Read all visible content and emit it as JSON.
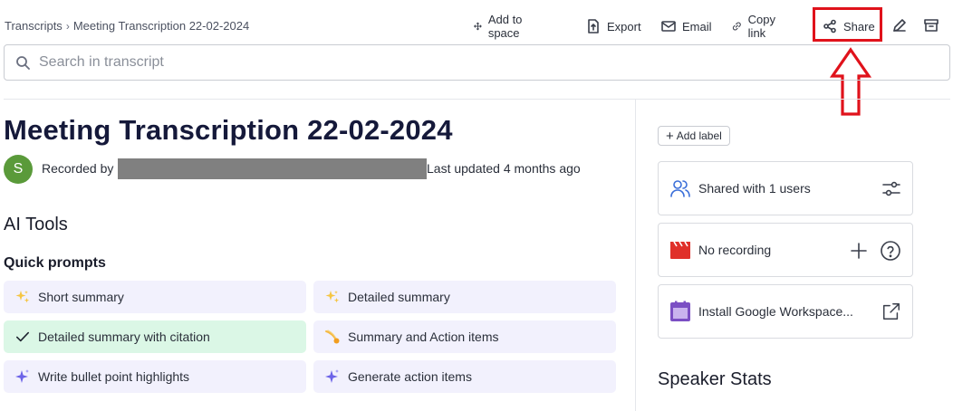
{
  "breadcrumb": {
    "root": "Transcripts",
    "current": "Meeting Transcription 22-02-2024"
  },
  "toolbar": {
    "add_to_space": "Add to space",
    "export": "Export",
    "email": "Email",
    "copy_link": "Copy link",
    "share": "Share"
  },
  "search": {
    "placeholder": "Search in transcript"
  },
  "meeting": {
    "title": "Meeting Transcription 22-02-2024",
    "avatar_initial": "S",
    "recorded_by": "Recorded by",
    "last_updated": "Last updated 4 months ago"
  },
  "ai_tools": {
    "heading": "AI Tools",
    "quick_prompts_heading": "Quick prompts",
    "prompts": [
      {
        "label": "Short summary",
        "icon": "sparkles-icon"
      },
      {
        "label": "Detailed summary",
        "icon": "sparkles-icon"
      },
      {
        "label": "Detailed summary with citation",
        "icon": "check-icon",
        "active": true
      },
      {
        "label": "Summary and Action items",
        "icon": "comet-icon"
      },
      {
        "label": "Write bullet point highlights",
        "icon": "sparkle-purple-icon"
      },
      {
        "label": "Generate action items",
        "icon": "sparkle-purple-icon"
      }
    ]
  },
  "sidebar": {
    "add_label": "Add label",
    "shared": "Shared with 1 users",
    "no_recording": "No recording",
    "install": "Install Google Workspace...",
    "speaker_stats": "Speaker Stats"
  },
  "colors": {
    "accent_highlight": "#e0121b",
    "prompt_bg": "#f2f1fd",
    "prompt_active_bg": "#dbf7e6",
    "avatar": "#5a9a3a"
  }
}
